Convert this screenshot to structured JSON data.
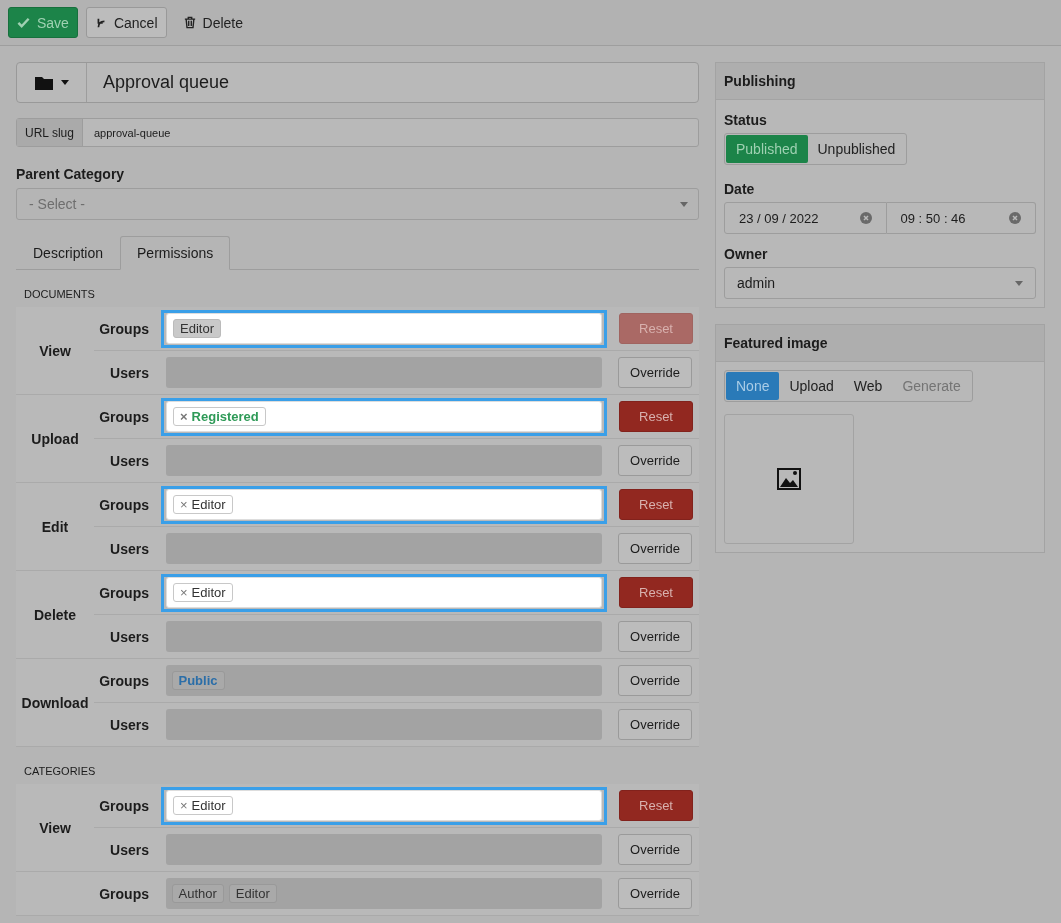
{
  "toolbar": [
    {
      "label": "Save",
      "kind": "primary"
    },
    {
      "label": "Cancel",
      "kind": "default"
    },
    {
      "label": "Delete",
      "kind": "link"
    }
  ],
  "title": {
    "value": "Approval queue"
  },
  "slug": {
    "label": "URL slug",
    "value": "approval-queue"
  },
  "parent": {
    "label": "Parent Category",
    "placeholder": "- Select -"
  },
  "tabs": [
    {
      "label": "Description",
      "selected": false
    },
    {
      "label": "Permissions",
      "selected": true
    }
  ],
  "sections": [
    {
      "title": "DOCUMENTS",
      "actions": [
        {
          "label": "View",
          "rows": [
            {
              "label": "Groups",
              "editable": true,
              "tags": [
                {
                  "text": "Editor",
                  "kind": "grey"
                }
              ],
              "button": {
                "label": "Reset",
                "kind": "danger",
                "disabled": true
              }
            },
            {
              "label": "Users",
              "editable": false,
              "tags": [],
              "button": {
                "label": "Override",
                "kind": "default"
              }
            }
          ]
        },
        {
          "label": "Upload",
          "rows": [
            {
              "label": "Groups",
              "editable": true,
              "tags": [
                {
                  "text": "Registered",
                  "remove": "×",
                  "kind": "green"
                }
              ],
              "button": {
                "label": "Reset",
                "kind": "danger",
                "disabled": false
              }
            },
            {
              "label": "Users",
              "editable": false,
              "tags": [],
              "button": {
                "label": "Override",
                "kind": "default"
              }
            }
          ]
        },
        {
          "label": "Edit",
          "rows": [
            {
              "label": "Groups",
              "editable": true,
              "tags": [
                {
                  "text": "Editor",
                  "remove": "×",
                  "kind": "plain"
                }
              ],
              "button": {
                "label": "Reset",
                "kind": "danger",
                "disabled": false
              }
            },
            {
              "label": "Users",
              "editable": false,
              "tags": [],
              "button": {
                "label": "Override",
                "kind": "default"
              }
            }
          ]
        },
        {
          "label": "Delete",
          "rows": [
            {
              "label": "Groups",
              "editable": true,
              "tags": [
                {
                  "text": "Editor",
                  "remove": "×",
                  "kind": "plain"
                }
              ],
              "button": {
                "label": "Reset",
                "kind": "danger",
                "disabled": false
              }
            },
            {
              "label": "Users",
              "editable": false,
              "tags": [],
              "button": {
                "label": "Override",
                "kind": "default"
              }
            }
          ]
        },
        {
          "label": "Download",
          "rows": [
            {
              "label": "Groups",
              "editable": false,
              "tags": [
                {
                  "text": "Public",
                  "kind": "blue"
                }
              ],
              "button": {
                "label": "Override",
                "kind": "default"
              }
            },
            {
              "label": "Users",
              "editable": false,
              "tags": [],
              "button": {
                "label": "Override",
                "kind": "default"
              }
            }
          ]
        }
      ]
    },
    {
      "title": "CATEGORIES",
      "actions": [
        {
          "label": "View",
          "rows": [
            {
              "label": "Groups",
              "editable": true,
              "tags": [
                {
                  "text": "Editor",
                  "remove": "×",
                  "kind": "plain"
                }
              ],
              "button": {
                "label": "Reset",
                "kind": "danger",
                "disabled": false
              }
            },
            {
              "label": "Users",
              "editable": false,
              "tags": [],
              "button": {
                "label": "Override",
                "kind": "default"
              }
            }
          ]
        },
        {
          "rows": [
            {
              "label": "Groups",
              "editable": false,
              "tags": [
                {
                  "text": "Author",
                  "kind": "grey"
                },
                {
                  "text": "Editor",
                  "kind": "grey"
                }
              ],
              "button": {
                "label": "Override",
                "kind": "default"
              }
            }
          ]
        }
      ]
    }
  ],
  "publishing": {
    "title": "Publishing",
    "status_label": "Status",
    "status": [
      {
        "label": "Published",
        "selected": true
      },
      {
        "label": "Unpublished",
        "selected": false
      }
    ],
    "date_label": "Date",
    "date": "23 / 09 / 2022",
    "time": "09 : 50 : 46",
    "owner_label": "Owner",
    "owner": "admin"
  },
  "featured": {
    "title": "Featured image",
    "sources": [
      {
        "label": "None",
        "selected": true,
        "disabled": false
      },
      {
        "label": "Upload",
        "selected": false,
        "disabled": false
      },
      {
        "label": "Web",
        "selected": false,
        "disabled": false
      },
      {
        "label": "Generate",
        "selected": false,
        "disabled": true
      }
    ]
  }
}
